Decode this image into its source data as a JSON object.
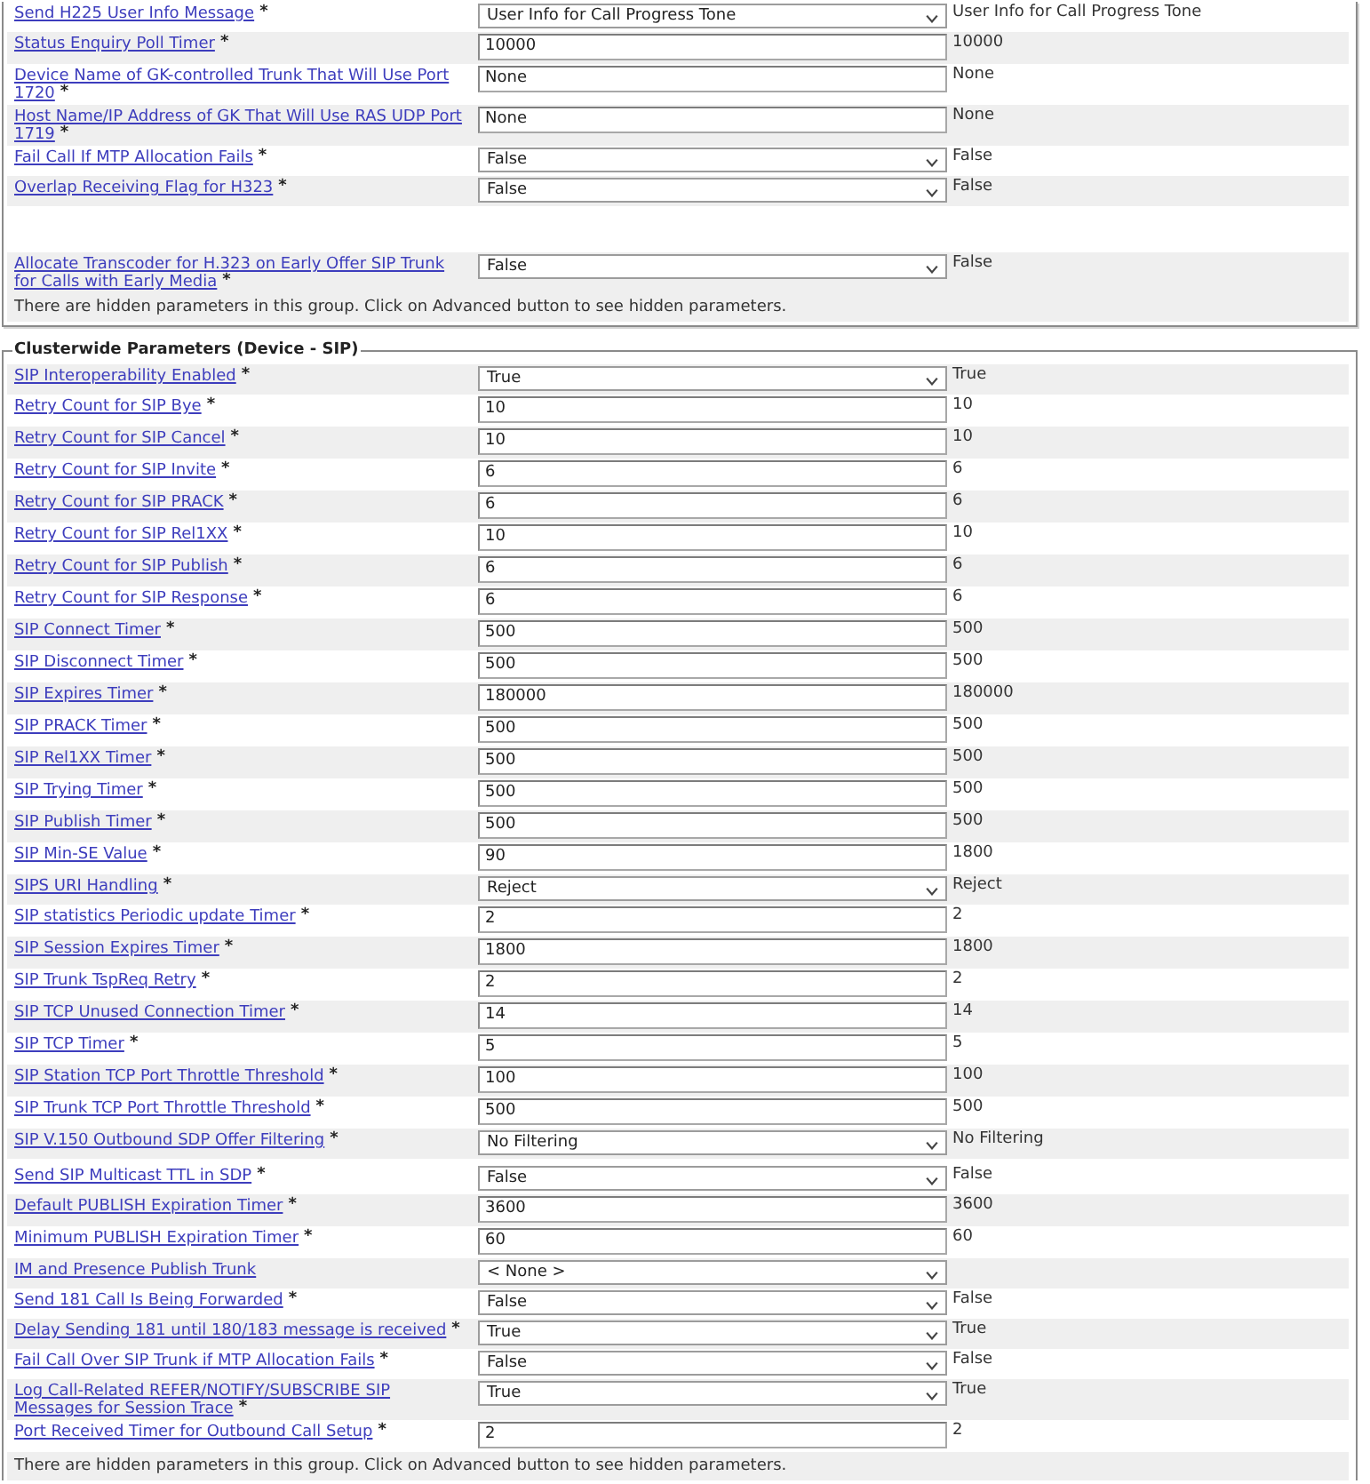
{
  "sections": [
    {
      "rows": [
        {
          "label": "Send H225 User Info Message",
          "mark": "*",
          "kind": "select",
          "value": "User Info for Call Progress Tone",
          "default": "User Info for Call Progress Tone"
        },
        {
          "label": "Status Enquiry Poll Timer",
          "mark": "*",
          "kind": "input",
          "value": "10000",
          "default": "10000"
        },
        {
          "label": "Device Name of GK-controlled Trunk That Will Use Port 1720",
          "mark": "*",
          "kind": "input",
          "value": "None",
          "default": "None"
        },
        {
          "label": "Host Name/IP Address of GK That Will Use RAS UDP Port 1719",
          "mark": "*",
          "kind": "input",
          "value": "None",
          "default": "None"
        },
        {
          "label": "Fail Call If MTP Allocation Fails",
          "mark": "*",
          "kind": "select",
          "value": "False",
          "default": "False"
        },
        {
          "label": "Overlap Receiving Flag for H323",
          "mark": "*",
          "kind": "select",
          "value": "False",
          "default": "False"
        },
        {
          "label": "Allocate Transcoder for H.323 on Early Offer SIP Trunk for Calls with Early Media",
          "mark": "*",
          "kind": "select",
          "value": "False",
          "default": "False"
        }
      ],
      "note": "There are hidden parameters in this group. Click on Advanced button to see hidden parameters."
    },
    {
      "title": "Clusterwide Parameters (Device - SIP)",
      "rows": [
        {
          "label": "SIP Interoperability Enabled",
          "mark": "*",
          "kind": "select",
          "value": "True",
          "default": "True"
        },
        {
          "label": "Retry Count for SIP Bye",
          "mark": "*",
          "kind": "input",
          "value": "10",
          "default": "10"
        },
        {
          "label": "Retry Count for SIP Cancel",
          "mark": "*",
          "kind": "input",
          "value": "10",
          "default": "10"
        },
        {
          "label": "Retry Count for SIP Invite",
          "mark": "*",
          "kind": "input",
          "value": "6",
          "default": "6"
        },
        {
          "label": "Retry Count for SIP PRACK",
          "mark": "*",
          "kind": "input",
          "value": "6",
          "default": "6"
        },
        {
          "label": "Retry Count for SIP Rel1XX",
          "mark": "*",
          "kind": "input",
          "value": "10",
          "default": "10"
        },
        {
          "label": "Retry Count for SIP Publish",
          "mark": "*",
          "kind": "input",
          "value": "6",
          "default": "6"
        },
        {
          "label": "Retry Count for SIP Response",
          "mark": "*",
          "kind": "input",
          "value": "6",
          "default": "6"
        },
        {
          "label": "SIP Connect Timer",
          "mark": "*",
          "kind": "input",
          "value": "500",
          "default": "500"
        },
        {
          "label": "SIP Disconnect Timer",
          "mark": "*",
          "kind": "input",
          "value": "500",
          "default": "500"
        },
        {
          "label": "SIP Expires Timer",
          "mark": "*",
          "kind": "input",
          "value": "180000",
          "default": "180000"
        },
        {
          "label": "SIP PRACK Timer",
          "mark": "*",
          "kind": "input",
          "value": "500",
          "default": "500"
        },
        {
          "label": "SIP Rel1XX Timer",
          "mark": "*",
          "kind": "input",
          "value": "500",
          "default": "500"
        },
        {
          "label": "SIP Trying Timer",
          "mark": "*",
          "kind": "input",
          "value": "500",
          "default": "500"
        },
        {
          "label": "SIP Publish Timer",
          "mark": "*",
          "kind": "input",
          "value": "500",
          "default": "500"
        },
        {
          "label": "SIP Min-SE Value",
          "mark": "*",
          "kind": "input",
          "value": "90",
          "default": "1800"
        },
        {
          "label": "SIPS URI Handling",
          "mark": "*",
          "kind": "select",
          "value": "Reject",
          "default": "Reject"
        },
        {
          "label": "SIP statistics Periodic update Timer",
          "mark": "*",
          "kind": "input",
          "value": "2",
          "default": "2"
        },
        {
          "label": "SIP Session Expires Timer",
          "mark": "*",
          "kind": "input",
          "value": "1800",
          "default": "1800"
        },
        {
          "label": "SIP Trunk TspReq Retry",
          "mark": "*",
          "kind": "input",
          "value": "2",
          "default": "2"
        },
        {
          "label": "SIP TCP Unused Connection Timer",
          "mark": "*",
          "kind": "input",
          "value": "14",
          "default": "14"
        },
        {
          "label": "SIP TCP Timer",
          "mark": "*",
          "kind": "input",
          "value": "5",
          "default": "5"
        },
        {
          "label": "SIP Station TCP Port Throttle Threshold",
          "mark": "*",
          "kind": "input",
          "value": "100",
          "default": "100"
        },
        {
          "label": "SIP Trunk TCP Port Throttle Threshold",
          "mark": "*",
          "kind": "input",
          "value": "500",
          "default": "500"
        },
        {
          "label": "SIP V.150 Outbound SDP Offer Filtering",
          "mark": "*",
          "kind": "select",
          "value": "No Filtering",
          "default": "No Filtering"
        },
        {
          "label": "Send SIP Multicast TTL in SDP",
          "mark": "*",
          "kind": "select",
          "value": "False",
          "default": "False"
        },
        {
          "label": "Default PUBLISH Expiration Timer",
          "mark": "*",
          "kind": "input",
          "value": "3600",
          "default": "3600"
        },
        {
          "label": "Minimum PUBLISH Expiration Timer",
          "mark": "*",
          "kind": "input",
          "value": "60",
          "default": "60"
        },
        {
          "label": "IM and Presence Publish Trunk",
          "kind": "select",
          "value": "< None >"
        },
        {
          "label": "Send 181 Call Is Being Forwarded",
          "mark": "*",
          "kind": "select",
          "value": "False",
          "default": "False"
        },
        {
          "label": "Delay Sending 181 until 180/183 message is received",
          "mark": "*",
          "kind": "select",
          "value": "True",
          "default": "True"
        },
        {
          "label": "Fail Call Over SIP Trunk if MTP Allocation Fails",
          "mark": "*",
          "kind": "select",
          "value": "False",
          "default": "False"
        },
        {
          "label": "Log Call-Related REFER/NOTIFY/SUBSCRIBE SIP Messages for Session Trace",
          "mark": "*",
          "kind": "select",
          "value": "True",
          "default": "True"
        },
        {
          "label": "Port Received Timer for Outbound Call Setup",
          "mark": "*",
          "kind": "input",
          "value": "2",
          "default": "2"
        }
      ],
      "note": "There are hidden parameters in this group. Click on Advanced button to see hidden parameters."
    }
  ]
}
